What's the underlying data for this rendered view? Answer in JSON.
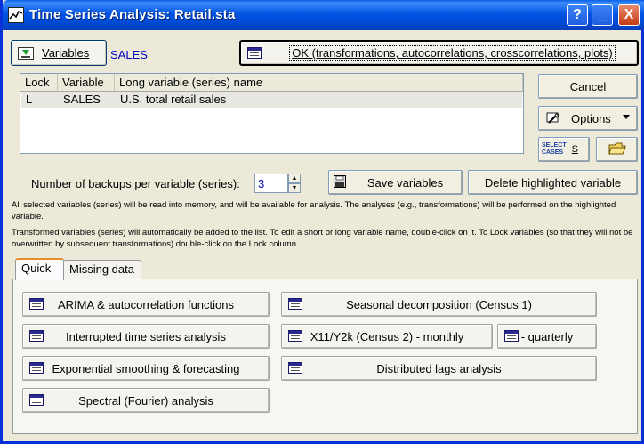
{
  "window": {
    "title": "Time Series Analysis: Retail.sta"
  },
  "titlebar_buttons": {
    "help": "?",
    "minimize": "_",
    "close": "X"
  },
  "variables_button": "Variables",
  "selected_variable": "SALES",
  "ok_button": "OK (transformations, autocorrelations, crosscorrelations, plots)",
  "cancel_button": "Cancel",
  "options_button": "Options",
  "select_cases": {
    "icon_text_1": "SELECT",
    "icon_text_2": "CASES",
    "label": "S"
  },
  "table": {
    "headers": [
      "Lock",
      "Variable",
      "Long variable (series) name"
    ],
    "rows": [
      {
        "lock": "L",
        "variable": "SALES",
        "long_name": "U.S. total retail sales"
      }
    ]
  },
  "backups": {
    "label": "Number of backups per variable (series):",
    "value": "3"
  },
  "save_variables_button": "Save variables",
  "delete_button": "Delete highlighted variable",
  "info_text_1": "All selected variables (series) will be read into memory, and will be available for analysis. The analyses (e.g., transformations) will be performed on the highlighted variable.",
  "info_text_2": "Transformed variables (series) will automatically be added to the list. To edit a short or long variable name, double-click on it. To Lock variables (so that they will not be overwritten by subsequent transformations) double-click on the Lock column.",
  "tabs": [
    "Quick",
    "Missing data"
  ],
  "quick_buttons": {
    "arima": "ARIMA & autocorrelation functions",
    "interrupted": "Interrupted time series analysis",
    "exponential": "Exponential smoothing & forecasting",
    "spectral": "Spectral (Fourier) analysis",
    "seasonal": "Seasonal decomposition (Census 1)",
    "x11_monthly": "X11/Y2k (Census 2) - monthly",
    "x11_quarterly": "- quarterly",
    "distributed": "Distributed lags analysis"
  }
}
